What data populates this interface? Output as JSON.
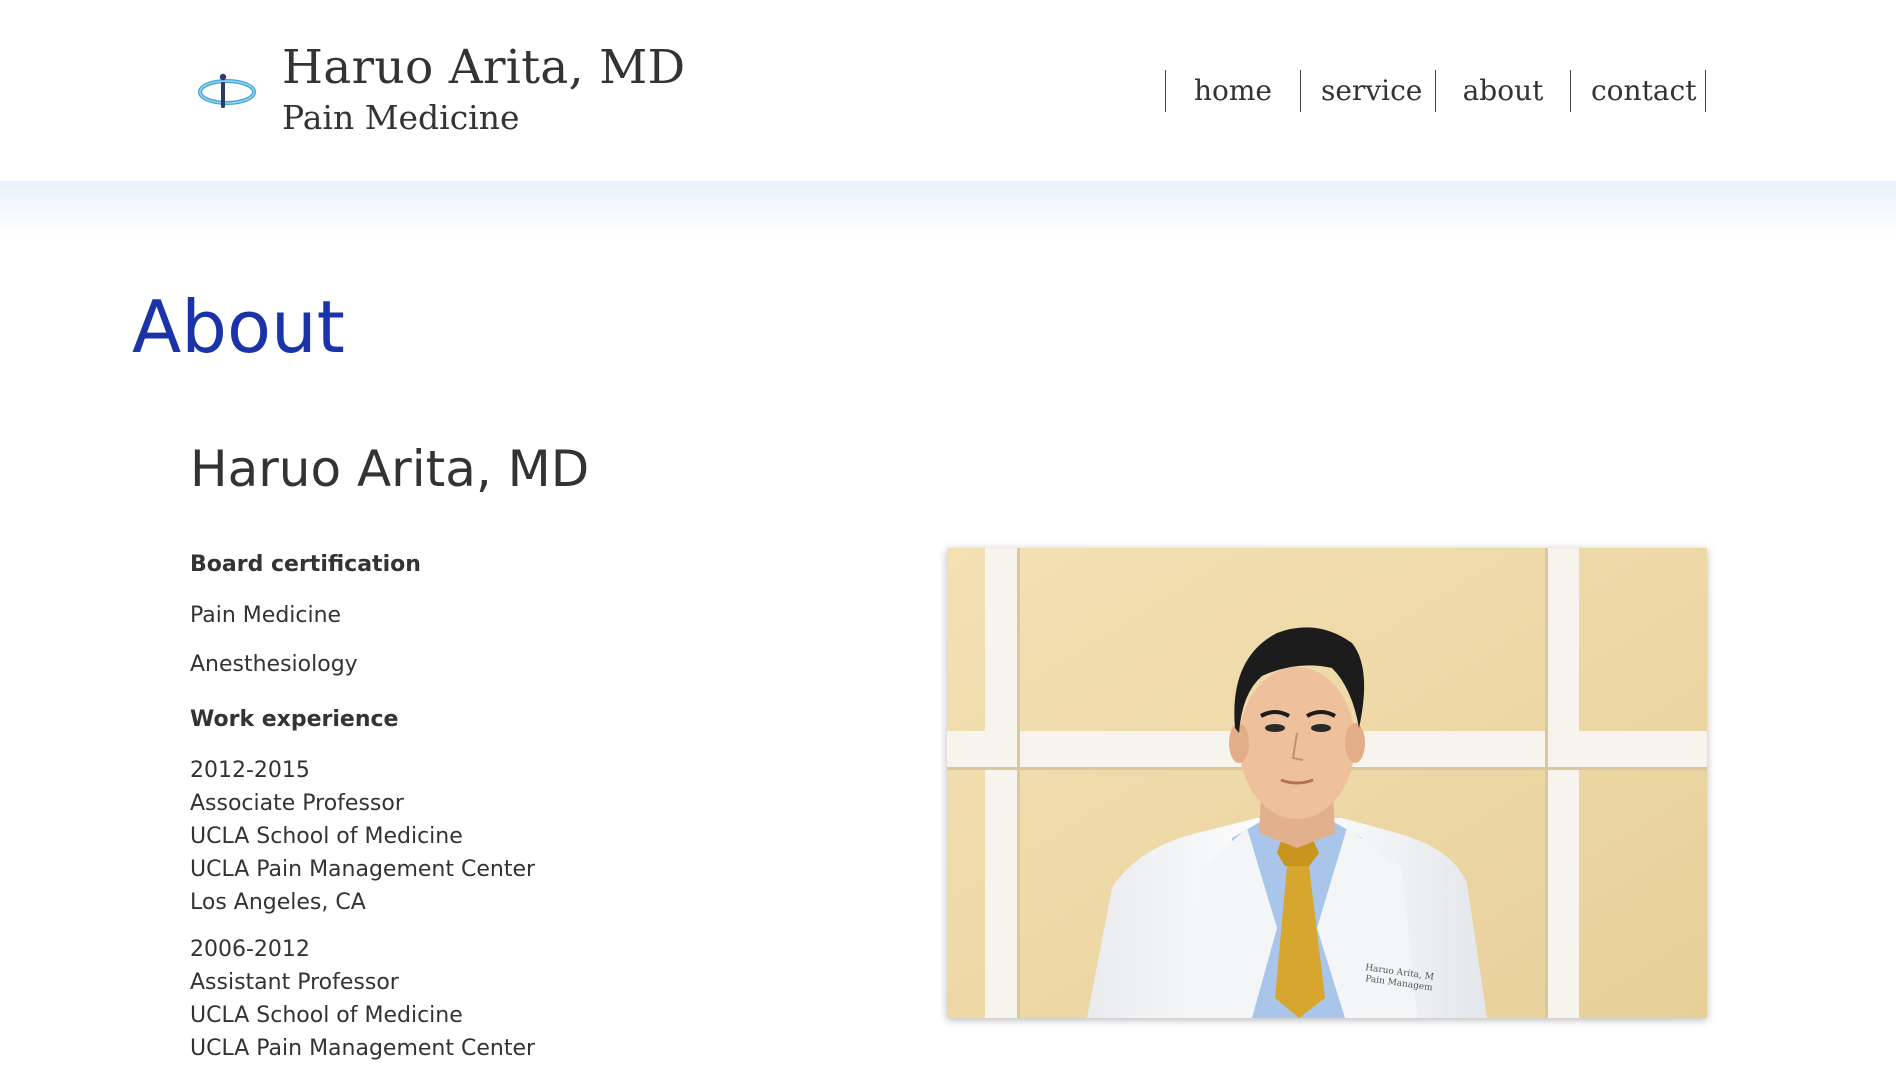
{
  "header": {
    "brand_name": "Haruo Arita, MD",
    "brand_subtitle": "Pain Medicine",
    "nav": [
      "home",
      "service",
      "about",
      "contact"
    ]
  },
  "page": {
    "title": "About",
    "doctor_name": "Haruo Arita, MD"
  },
  "board_certification": {
    "heading": "Board certification",
    "items": [
      "Pain Medicine",
      "Anesthesiology"
    ]
  },
  "work_experience": {
    "heading": "Work experience",
    "entries": [
      {
        "years": "2012-2015",
        "title": "Associate Professor",
        "school": "UCLA School of Medicine",
        "center": "UCLA Pain Management Center",
        "location": "Los Angeles, CA"
      },
      {
        "years": "2006-2012",
        "title": "Assistant Professor",
        "school": "UCLA School of Medicine",
        "center": "UCLA Pain Management Center"
      }
    ]
  },
  "photo": {
    "coat_embroidery_line1": "Haruo Arita, M",
    "coat_embroidery_line2": "Pain Managem"
  },
  "colors": {
    "title_blue": "#1a33a8",
    "text": "#333333",
    "logo_blue": "#3ba3d9"
  }
}
